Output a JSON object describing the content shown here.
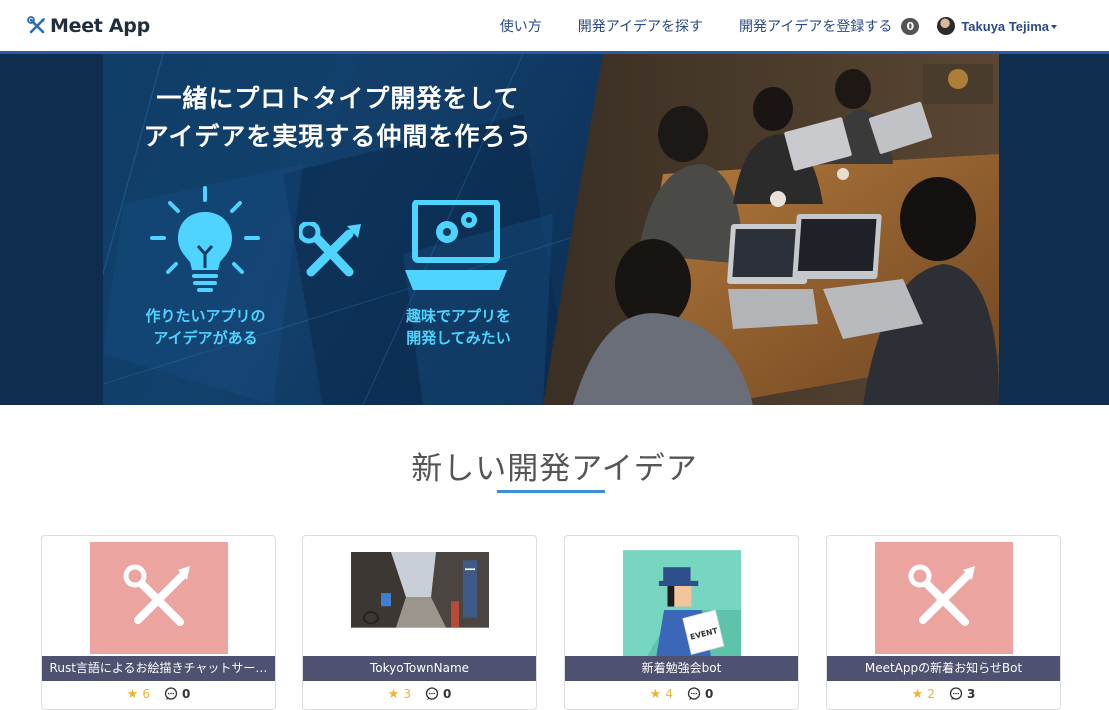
{
  "header": {
    "logo_text": "Meet App",
    "nav": [
      "使い方",
      "開発アイデアを探す",
      "開発アイデアを登録する"
    ],
    "notification_count": "0",
    "user_name": "Takuya Tejima"
  },
  "hero": {
    "title_line1": "一緒にプロトタイプ開発をして",
    "title_line2": "アイデアを実現する仲間を作ろう",
    "caption1_line1": "作りたいアプリの",
    "caption1_line2": "アイデアがある",
    "caption2_line1": "趣味でアプリを",
    "caption2_line2": "開発してみたい"
  },
  "section": {
    "title": "新しい開発アイデア"
  },
  "ideas": [
    {
      "title": "Rust言語によるお絵描きチャットサー…",
      "stars": "6",
      "comments": "0",
      "thumbnail": "tools-icon"
    },
    {
      "title": "TokyoTownName",
      "stars": "3",
      "comments": "0",
      "thumbnail": "street-photo"
    },
    {
      "title": "新着勉強会bot",
      "stars": "4",
      "comments": "0",
      "thumbnail": "mailman-illustration"
    },
    {
      "title": "MeetAppの新着お知らせBot",
      "stars": "2",
      "comments": "3",
      "thumbnail": "tools-icon"
    }
  ],
  "colors": {
    "header_border": "#2a5aa8",
    "hero_bg": "#0f2d4e",
    "accent_cyan": "#4fd3ff",
    "card_title_bar": "#4e5170",
    "tools_thumb_bg": "#eba49f",
    "star": "#f2b233",
    "section_underline": "#3a8fd8"
  }
}
